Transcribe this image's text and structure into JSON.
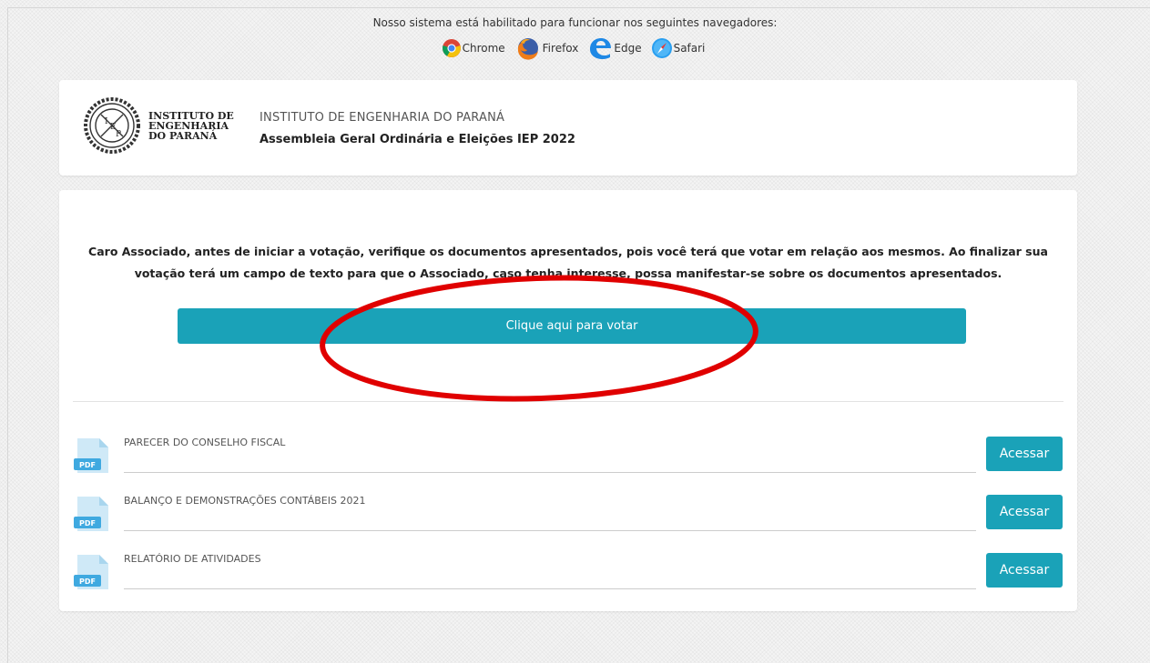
{
  "browsers_note": "Nosso sistema está habilitado para funcionar nos seguintes navegadores:",
  "browsers": [
    {
      "label": "Chrome",
      "icon": "chrome-icon"
    },
    {
      "label": "Firefox",
      "icon": "firefox-icon"
    },
    {
      "label": "Edge",
      "icon": "edge-icon"
    },
    {
      "label": "Safari",
      "icon": "safari-icon"
    }
  ],
  "header": {
    "logo_lines": [
      "INSTITUTO DE",
      "ENGENHARIA",
      "DO PARANÁ"
    ],
    "org_name": "INSTITUTO DE ENGENHARIA DO PARANÁ",
    "event_name": "Assembleia Geral Ordinária e Eleições IEP 2022"
  },
  "main": {
    "instructions": "Caro Associado, antes de iniciar a votação, verifique os documentos apresentados, pois você terá que votar em relação aos mesmos. Ao finalizar sua votação terá um campo de texto para que o Associado, caso tenha interesse, possa manifestar-se sobre os documentos apresentados.",
    "vote_button": "Clique aqui para votar",
    "documents": [
      {
        "title": "PARECER DO CONSELHO FISCAL",
        "button": "Acessar",
        "icon_label": "PDF"
      },
      {
        "title": "BALANÇO E DEMONSTRAÇÕES CONTÁBEIS 2021",
        "button": "Acessar",
        "icon_label": "PDF"
      },
      {
        "title": "RELATÓRIO DE ATIVIDADES",
        "button": "Acessar",
        "icon_label": "PDF"
      }
    ]
  },
  "colors": {
    "accent": "#1aa2b8",
    "annotation": "#e00000"
  }
}
